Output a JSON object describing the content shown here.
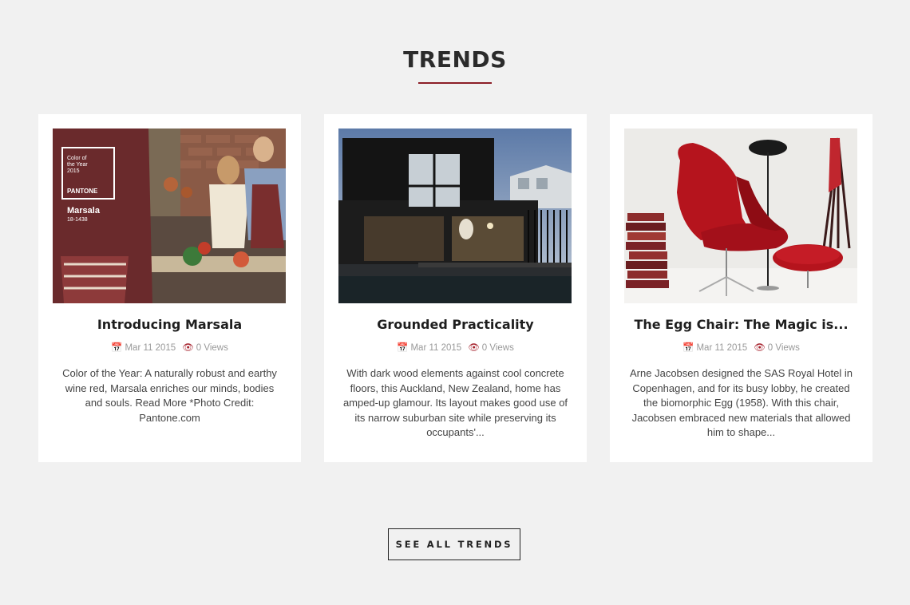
{
  "section": {
    "title": "TRENDS",
    "accent_color": "#8c1e28"
  },
  "cards": [
    {
      "title": "Introducing Marsala",
      "date": "Mar 11 2015",
      "views": "0 Views",
      "excerpt": "Color of the Year: A naturally robust and earthy wine red, Marsala enriches our minds, bodies and souls. Read More *Photo Credit: Pantone.com",
      "image": {
        "subject": "kitchen scene with people in marsala clothing",
        "swatch_line1": "Color of",
        "swatch_line2": "the Year",
        "swatch_year": "2015",
        "swatch_brand": "PANTONE",
        "swatch_name": "Marsala",
        "swatch_code": "18-1438"
      }
    },
    {
      "title": "Grounded Practicality",
      "date": "Mar 11 2015",
      "views": "0 Views",
      "excerpt": "With dark wood elements against cool concrete floors, this Auckland, New Zealand, home has amped-up glamour. Its layout makes good use of its narrow suburban site while preserving its occupants'...",
      "image": {
        "subject": "dark modern house at dusk"
      }
    },
    {
      "title": "The Egg Chair: The Magic is...",
      "date": "Mar 11 2015",
      "views": "0 Views",
      "excerpt": "Arne Jacobsen designed the SAS Royal Hotel in Copenhagen, and for its busy lobby, he created the biomorphic Egg (1958). With this chair, Jacobsen embraced new materials that allowed him to shape...",
      "image": {
        "subject": "red egg chair with ottoman, lamp and coat rack"
      }
    }
  ],
  "icons": {
    "date": "calendar-icon",
    "views": "eye-icon"
  },
  "cta": {
    "label": "SEE ALL TRENDS"
  }
}
